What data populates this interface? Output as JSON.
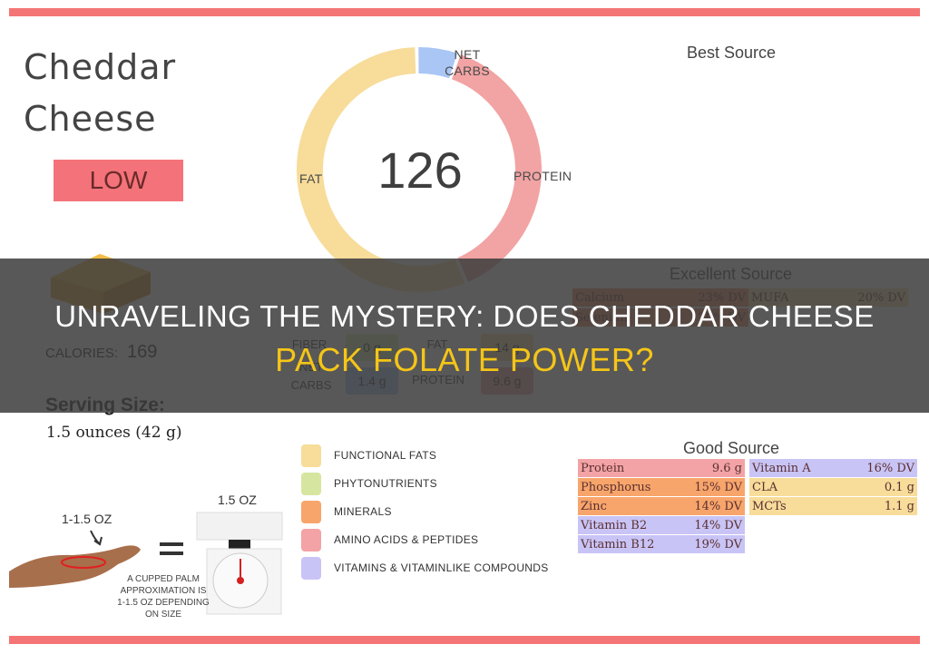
{
  "title": {
    "line1": "Cheddar",
    "line2": "Cheese",
    "badge": "LOW"
  },
  "donut": {
    "center_value": "126",
    "segments": [
      {
        "label": "FAT",
        "color": "#f7dc9a",
        "value": 14
      },
      {
        "label": "NET CARBS",
        "color": "#a9c6f5",
        "value": 1.4
      },
      {
        "label": "PROTEIN",
        "color": "#f2a3a3",
        "value": 9.6
      }
    ],
    "label_net_line1": "NET",
    "label_net_line2": "CARBS",
    "label_fat": "FAT",
    "label_protein": "PROTEIN"
  },
  "best_source": {
    "title": "Best Source"
  },
  "excellent_source": {
    "title": "Excellent Source",
    "rows": [
      {
        "name": "Calcium",
        "value": "23% DV",
        "color": "#f08a5d"
      },
      {
        "name": "MUFA",
        "value": "20% DV",
        "color": "#f7dc9a"
      },
      {
        "name": "Selenium",
        "value": "20% DV",
        "color": "#f08a5d"
      }
    ]
  },
  "nutrition": {
    "calories_label": "CALORIES:",
    "calories_value": "169",
    "macros": [
      {
        "label": "FIBER",
        "value": "0 g",
        "color": "#d6e6a0"
      },
      {
        "label": "FAT",
        "value": "14 g",
        "color": "#f7dc9a"
      },
      {
        "label": "NET CARBS",
        "label_line1": "NET",
        "label_line2": "CARBS",
        "value": "1.4 g",
        "color": "#a9c6f5"
      },
      {
        "label": "PROTEIN",
        "value": "9.6 g",
        "color": "#f2a3a3"
      }
    ],
    "serving_title": "Serving Size:",
    "serving_value": "1.5 ounces (42 g)"
  },
  "legend": [
    {
      "label": "FUNCTIONAL  FATS",
      "color": "#f7dc9a"
    },
    {
      "label": "PHYTONUTRIENTS",
      "color": "#d6e6a0"
    },
    {
      "label": "MINERALS",
      "color": "#f8a56b"
    },
    {
      "label": "AMINO ACIDS & PEPTIDES",
      "color": "#f3a3a6"
    },
    {
      "label": "VITAMINS & VITAMINLIKE COMPOUNDS",
      "color": "#c9c4f6"
    }
  ],
  "good_source": {
    "title": "Good Source",
    "left": [
      {
        "name": "Protein",
        "value": "9.6 g",
        "color": "#f3a3a6"
      },
      {
        "name": "Phosphorus",
        "value": "15% DV",
        "color": "#f8a56b"
      },
      {
        "name": "Zinc",
        "value": "14% DV",
        "color": "#f8a56b"
      },
      {
        "name": "Vitamin B2",
        "value": "14% DV",
        "color": "#c9c4f6"
      },
      {
        "name": "Vitamin B12",
        "value": "19% DV",
        "color": "#c9c4f6"
      }
    ],
    "right": [
      {
        "name": "Vitamin A",
        "value": "16% DV",
        "color": "#c9c4f6"
      },
      {
        "name": "CLA",
        "value": "0.1 g",
        "color": "#f7dc9a"
      },
      {
        "name": "MCTs",
        "value": "1.1 g",
        "color": "#f7dc9a"
      }
    ]
  },
  "illustration": {
    "palm_label": "1-1.5 OZ",
    "scale_label": "1.5 OZ",
    "note": "A CUPPED PALM APPROXIMATION IS 1-1.5 OZ DEPENDING ON SIZE"
  },
  "headline": {
    "line1": "UNRAVELING THE MYSTERY: DOES CHEDDAR CHEESE",
    "line2": "PACK FOLATE POWER?"
  },
  "colors": {
    "accent_rule": "#f47575",
    "badge": "#f4737a",
    "headline_highlight": "#f5c518",
    "overlay": "#3c3c3c"
  }
}
